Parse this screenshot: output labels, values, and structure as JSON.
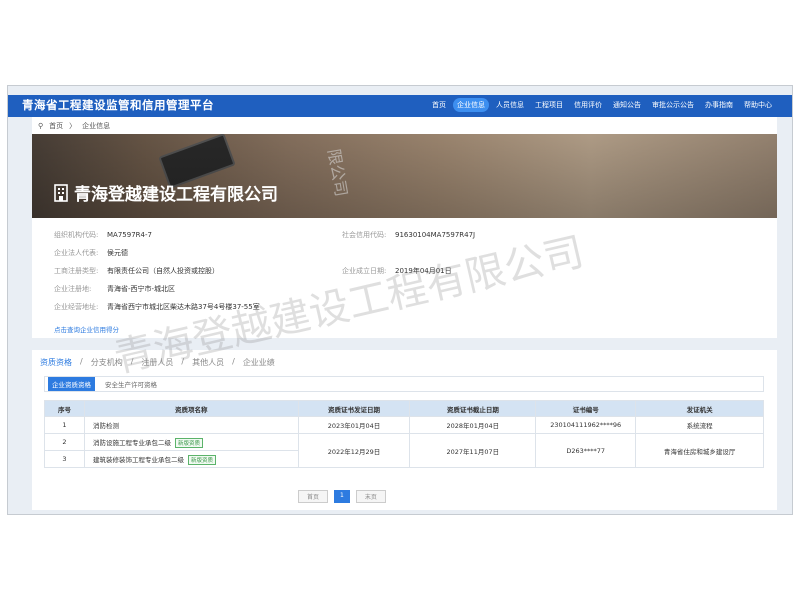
{
  "site_title": "青海省工程建设监管和信用管理平台",
  "nav": [
    "首页",
    "企业信息",
    "人员信息",
    "工程项目",
    "信用评价",
    "通知公告",
    "审批公示公告",
    "办事指南",
    "帮助中心"
  ],
  "breadcrumb": {
    "home": "首页",
    "sep": "〉",
    "current": "企业信息"
  },
  "company_name": "青海登越建设工程有限公司",
  "info": {
    "org_code_label": "组织机构代码:",
    "org_code": "MA7597R4-7",
    "credit_code_label": "社会信用代码:",
    "credit_code": "91630104MA7597R47J",
    "legal_rep_label": "企业法人代表:",
    "legal_rep": "侯元德",
    "reg_type_label": "工商注册类型:",
    "reg_type": "有限责任公司（自然人投资或控股）",
    "est_date_label": "企业成立日期:",
    "est_date": "2019年04月01日",
    "reg_place_label": "企业注册地:",
    "reg_place": "青海省-西宁市-城北区",
    "address_label": "企业经营地址:",
    "address": "青海省西宁市城北区柴达木路37号4号楼37-55室",
    "credit_link": "点击查询企业信用得分"
  },
  "tabs": [
    "资质资格",
    "/",
    "分支机构",
    "/",
    "注册人员",
    "/",
    "其他人员",
    "/",
    "企业业绩"
  ],
  "subtabs": [
    "企业资质资格",
    "安全生产许可资格"
  ],
  "table": {
    "headers": [
      "序号",
      "资质项名称",
      "资质证书发证日期",
      "资质证书截止日期",
      "证书编号",
      "发证机关"
    ],
    "rows": [
      {
        "no": "1",
        "name": "消防检测",
        "issue": "2023年01月04日",
        "expire": "2028年01月04日",
        "cert": "230104111962****96",
        "authority": "系统流程"
      },
      {
        "no": "2",
        "name": "消防设施工程专业承包二级",
        "tag": "新版资质",
        "issue": "2022年12月29日",
        "expire": "2027年11月07日",
        "cert": "D263****77",
        "authority": "青海省住房和城乡建设厅"
      },
      {
        "no": "3",
        "name": "建筑装修装饰工程专业承包二级",
        "tag": "新版资质"
      }
    ]
  },
  "pager": {
    "prev": "首页",
    "current": "1",
    "next": "末页"
  },
  "watermark": "青海登越建设工程有限公司",
  "watermark_vertical": "限公司"
}
